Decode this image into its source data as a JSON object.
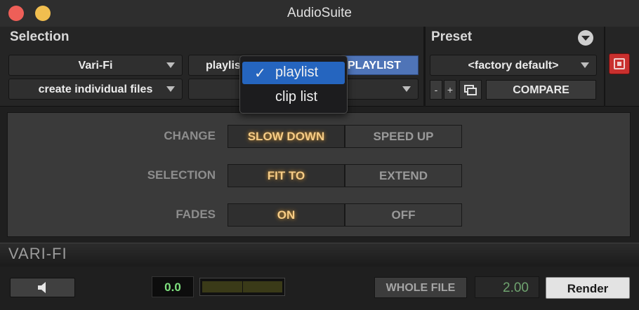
{
  "window": {
    "title": "AudioSuite"
  },
  "header": {
    "selection_label": "Selection",
    "preset_label": "Preset",
    "plugin_select": "Vari-Fi",
    "source_select": "playlist",
    "target_label": "PLAYLIST",
    "output_select": "create individual files",
    "preset_select": "<factory default>",
    "preset_minus": "-",
    "preset_plus": "+",
    "compare_label": "COMPARE"
  },
  "dropdown": {
    "items": [
      {
        "label": "playlist",
        "checked": true,
        "check": "✓"
      },
      {
        "label": "clip list",
        "checked": false
      }
    ]
  },
  "plugin": {
    "rows": [
      {
        "label": "CHANGE",
        "options": [
          "SLOW DOWN",
          "SPEED UP"
        ],
        "selected": "SLOW DOWN"
      },
      {
        "label": "SELECTION",
        "options": [
          "FIT TO",
          "EXTEND"
        ],
        "selected": "FIT TO"
      },
      {
        "label": "FADES",
        "options": [
          "ON",
          "OFF"
        ],
        "selected": "ON"
      }
    ]
  },
  "brand": {
    "name": "VARI-FI"
  },
  "footer": {
    "gain_value": "0.0",
    "whole_file_label": "WHOLE FILE",
    "handle_value": "2.00",
    "render_label": "Render"
  },
  "colors": {
    "active_text": "#f6cc86",
    "highlight": "#2565bf",
    "bypass_red": "#c9302e"
  }
}
